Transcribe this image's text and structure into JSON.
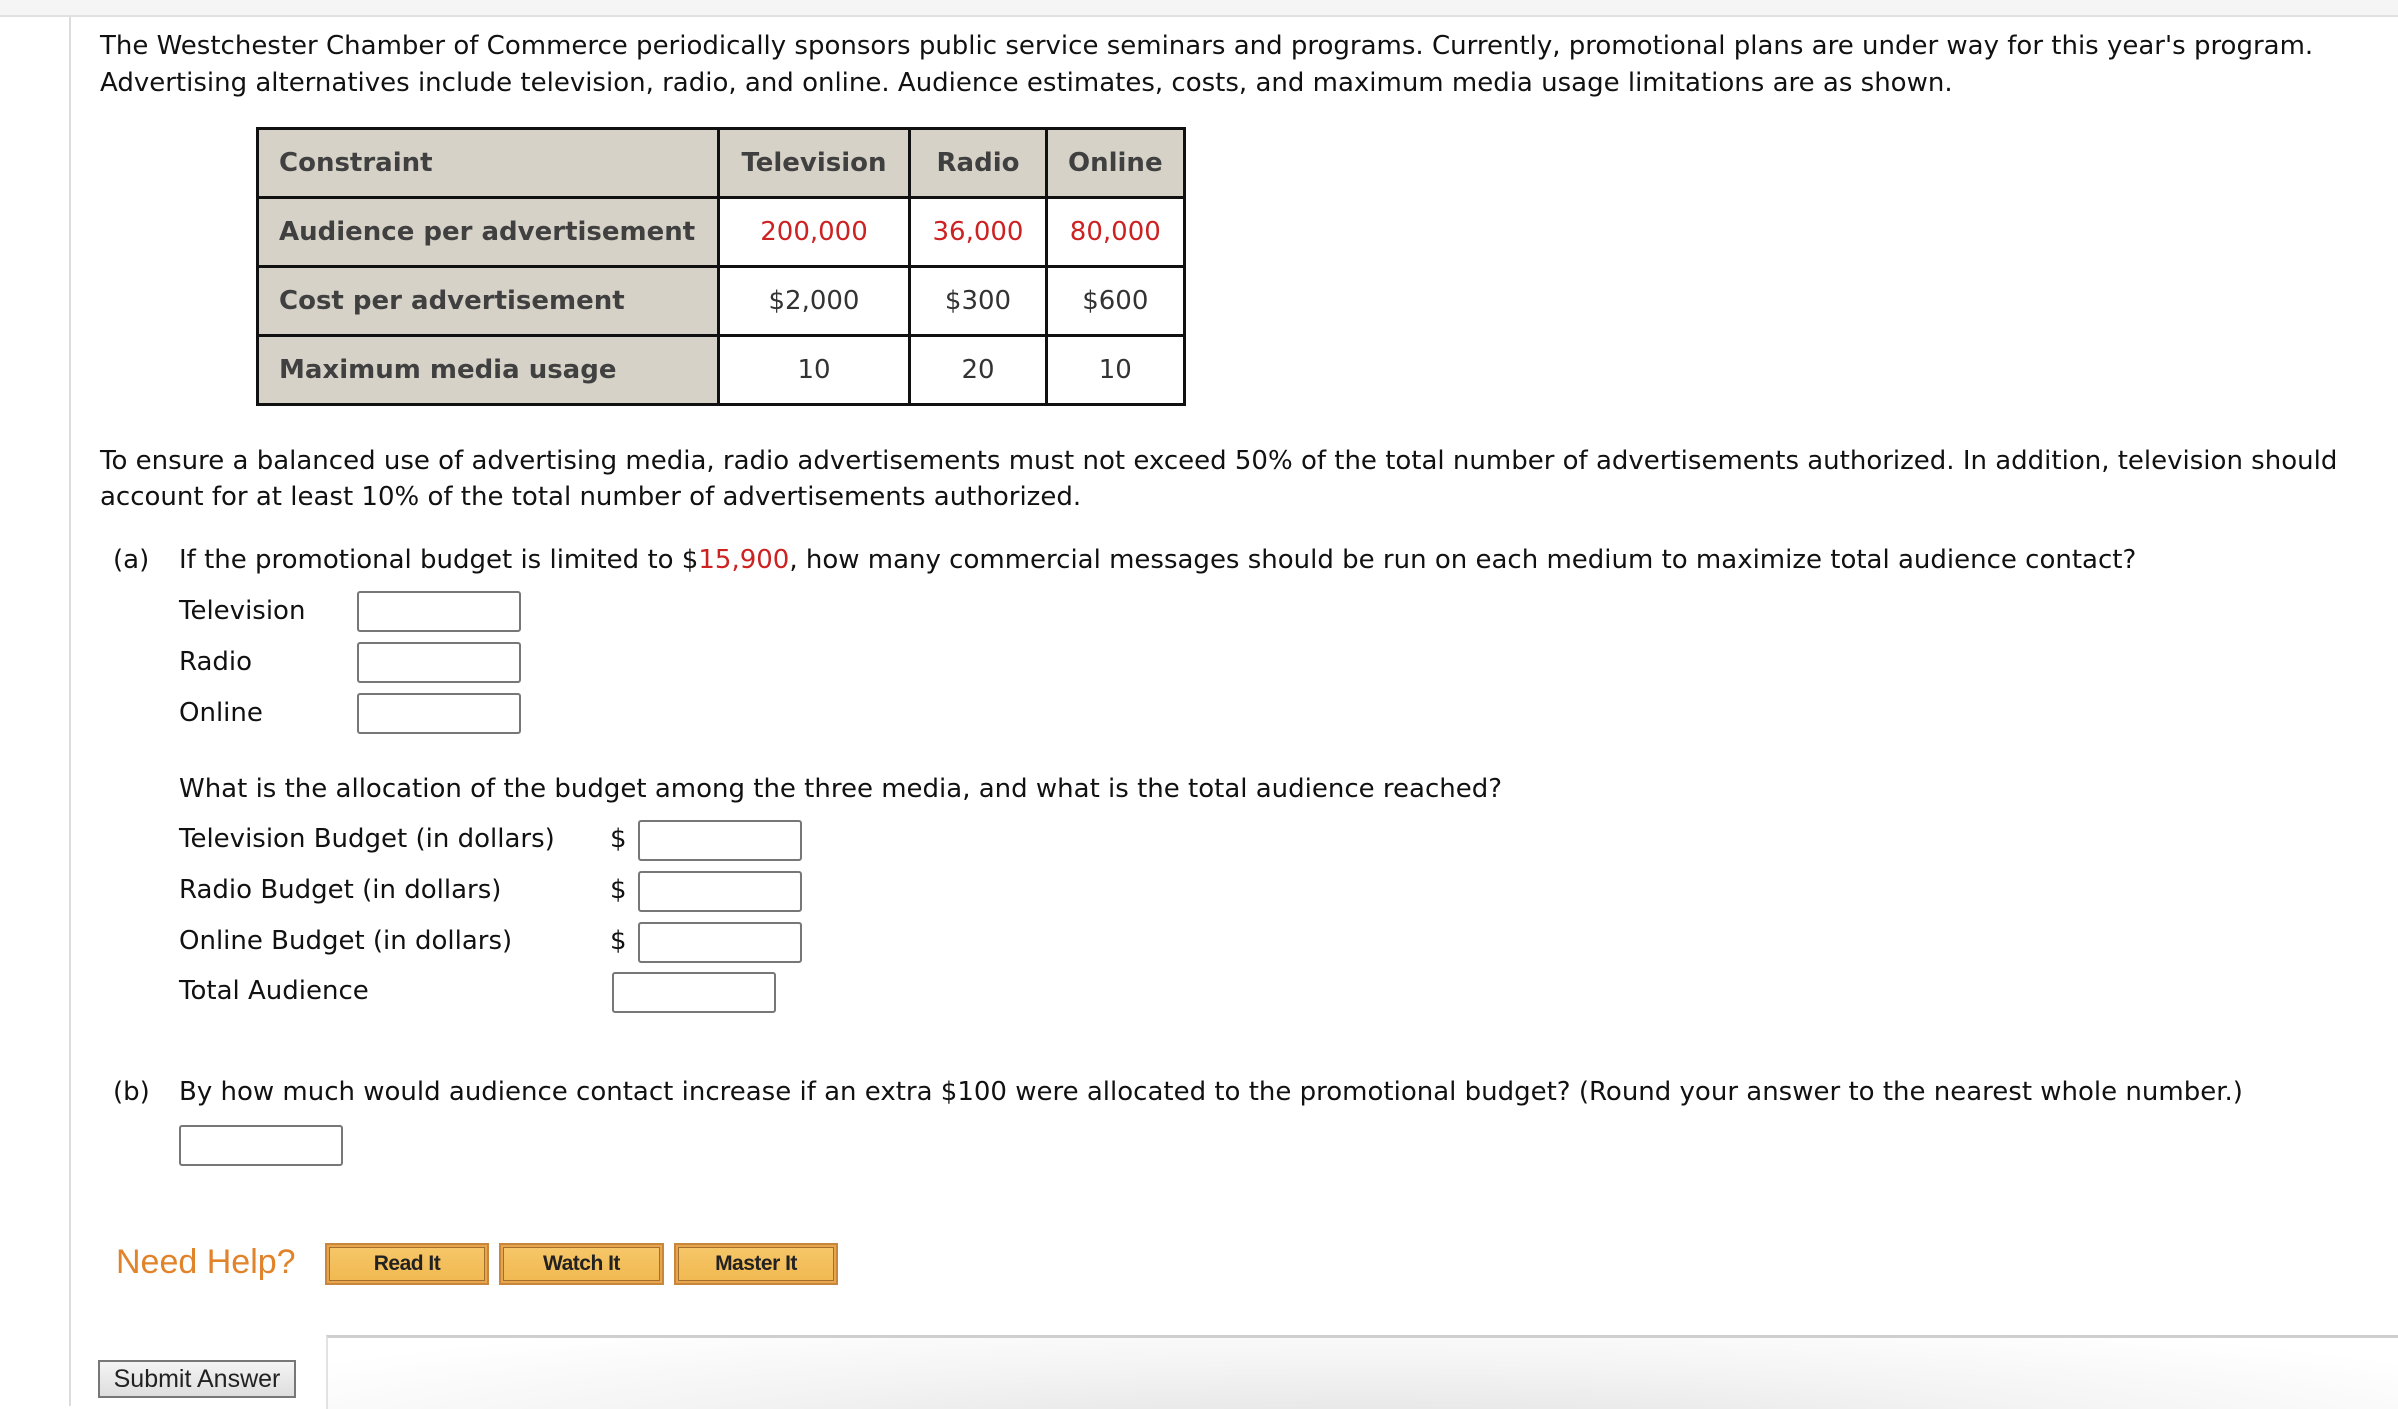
{
  "intro": {
    "line1": "The Westchester Chamber of Commerce periodically sponsors public service seminars and programs. Currently, promotional plans are under way for this year's program.",
    "line2": "Advertising alternatives include television, radio, and online. Audience estimates, costs, and maximum media usage limitations are as shown."
  },
  "table": {
    "headers": [
      "Constraint",
      "Television",
      "Radio",
      "Online"
    ],
    "rows": [
      {
        "label": "Audience per advertisement",
        "values": [
          "200,000",
          "36,000",
          "80,000"
        ],
        "highlight": true
      },
      {
        "label": "Cost per advertisement",
        "values": [
          "$2,000",
          "$300",
          "$600"
        ],
        "highlight": false
      },
      {
        "label": "Maximum media usage",
        "values": [
          "10",
          "20",
          "10"
        ],
        "highlight": false
      }
    ]
  },
  "balance": {
    "line1": "To ensure a balanced use of advertising media, radio advertisements must not exceed 50% of the total number of advertisements authorized. In addition, television should",
    "line2": "account for at least 10% of the total number of advertisements authorized."
  },
  "part_a": {
    "marker": "(a)",
    "question_pre": "If the promotional budget is limited to $",
    "budget": "15,900",
    "question_post": ", how many commercial messages should be run on each medium to maximize total audience contact?",
    "fields": [
      {
        "label": "Television",
        "value": ""
      },
      {
        "label": "Radio",
        "value": ""
      },
      {
        "label": "Online",
        "value": ""
      }
    ],
    "allocation_question": "What is the allocation of the budget among the three media, and what is the total audience reached?",
    "budget_fields": [
      {
        "label": "Television Budget (in dollars)",
        "prefix": "$",
        "value": ""
      },
      {
        "label": "Radio Budget (in dollars)",
        "prefix": "$",
        "value": ""
      },
      {
        "label": "Online Budget (in dollars)",
        "prefix": "$",
        "value": ""
      },
      {
        "label": "Total Audience",
        "prefix": "",
        "value": ""
      }
    ]
  },
  "part_b": {
    "marker": "(b)",
    "question": "By how much would audience contact increase if an extra $100 were allocated to the promotional budget? (Round your answer to the nearest whole number.)",
    "value": ""
  },
  "help": {
    "label": "Need Help?",
    "buttons": [
      "Read It",
      "Watch It",
      "Master It"
    ]
  },
  "submit_label": "Submit Answer",
  "colors": {
    "highlight": "#cc2222",
    "need_help": "#e0832a",
    "help_button": "#f3bf5c",
    "table_header": "#d6d2c8"
  }
}
